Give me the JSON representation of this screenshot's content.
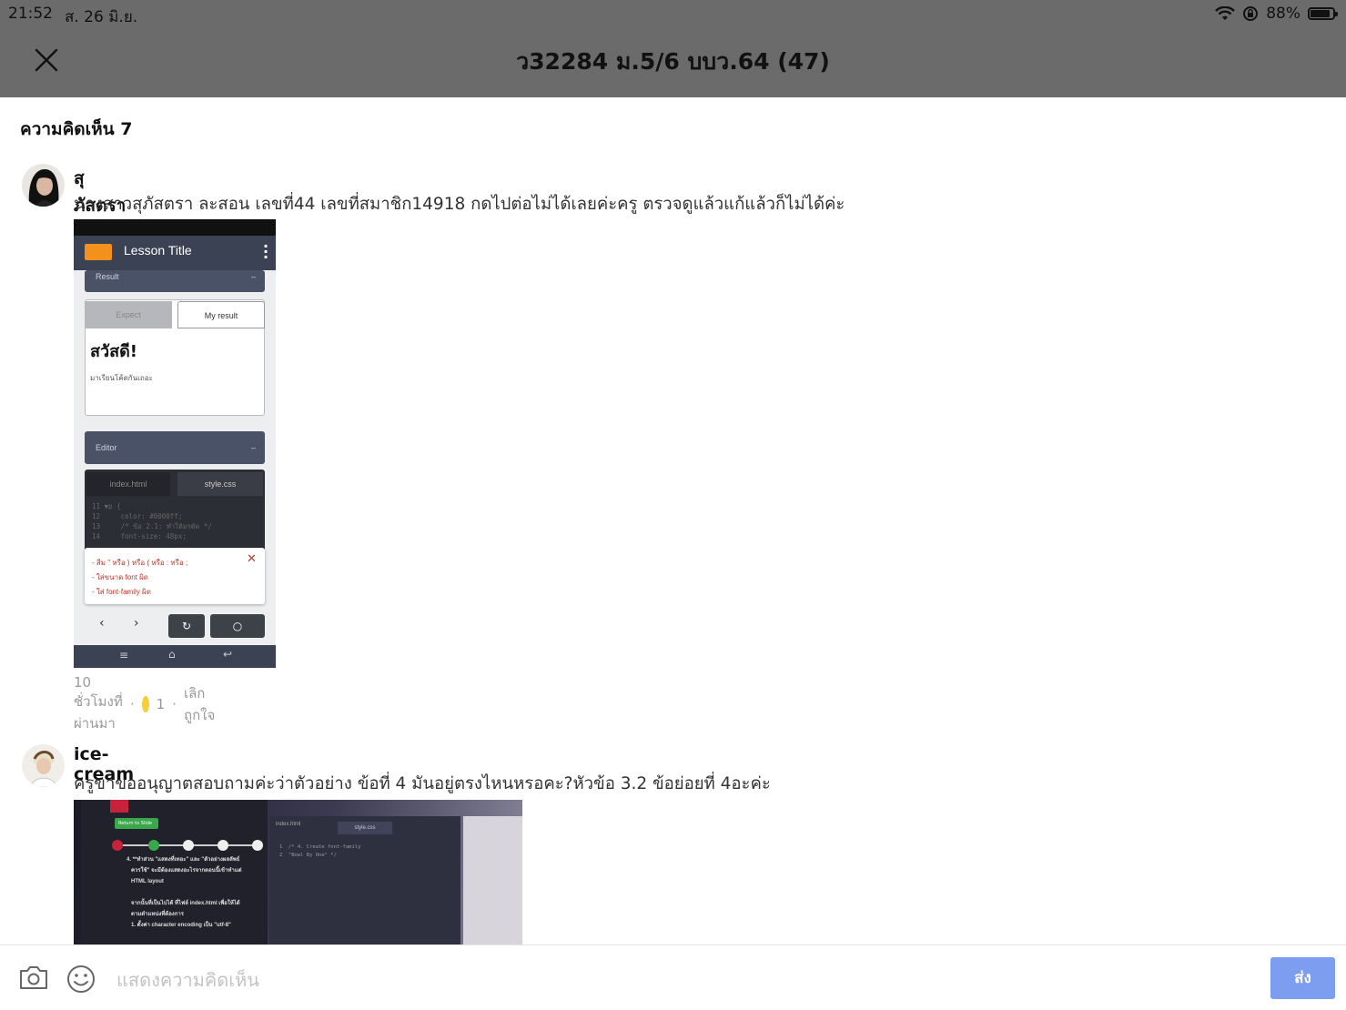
{
  "status_bar": {
    "time": "21:52",
    "date": "ส. 26 มิ.ย.",
    "battery": "88%",
    "battery_level": 0.88
  },
  "header": {
    "title": "ว32284 ม.5/6 บบว.64 (47)"
  },
  "comments_heading": "ความคิดเห็น 7",
  "comments": [
    {
      "username": "สุภัสตรา",
      "badge_icon": "fire-icon",
      "text": "นางสาวสุภัสตรา ละสอน เลขที่44 เลขที่สมาชิก14918 กดไปต่อไม่ได้เลยค่ะครู ตรวจดูแล้วแก้แล้วก็ไม่ได้ค่ะ",
      "time_ago": "10 ชั่วโมงที่ผ่านมา",
      "reaction_count": "1",
      "unlike_label": "เลิกถูกใจ",
      "attachment": {
        "app_title": "Lesson Title",
        "result_label": "Result",
        "tab_expect": "Expect",
        "tab_my_result": "My result",
        "greeting": "สวัสดี!",
        "subtext": "มาเรียนโค้ดกันเถอะ",
        "editor_label": "Editor",
        "file_tab_1": "index.html",
        "file_tab_2": "style.css",
        "code_lines": "11 ▼p {\n12     color: #0000ff;\n13     /* ข้อ 2.1: ทำให้มรตัด */\n14     font-size: 48px;",
        "errors": [
          "- สีม \" หรือ ) หรือ ( หรือ : หรือ ;",
          "- ใส่ขนาด font ผิด",
          "- ใส่ font-family ผิด"
        ]
      }
    },
    {
      "username": "ice-cream",
      "text": "ครูขาขออนุญาตสอบถามค่ะว่าตัวอย่าง ข้อที่ 4 มันอยู่ตรงไหนหรอคะ?หัวข้อ 3.2 ข้อย่อยที่ 4อะค่ะ",
      "attachment": {
        "back_button": "Return to Slide",
        "file_tab_1": "index.html",
        "file_tab_2": "style.css",
        "instruction": "4. **ทำส่วน \"แสดงที่เทอะ\" และ \"ตัวอย่างผลลัพธ์\n   ควรใช้\" จะมีต้องแสดงอะไรจากตอนนี้เข้าทำแต่\n   HTML layout\n\n   จากนั้นที่เป็นไปได้ ที่ไฟล์ index.html เพื่อให้ได้\n   ตามตำแหน่งที่ต้องการ\n   1. ตั้งค่า character encoding เป็น \"utf-8\"",
        "code": "1  /* 4. Create font-family  \n2  \"Bowl By One\" */"
      }
    }
  ],
  "input_bar": {
    "placeholder": "แสดงความคิดเห็น",
    "value": "",
    "send_label": "ส่ง"
  },
  "colors": {
    "top_bar": "#6b6b6b",
    "send_button": "#7d9df0",
    "reaction": "#f4cf3a"
  }
}
